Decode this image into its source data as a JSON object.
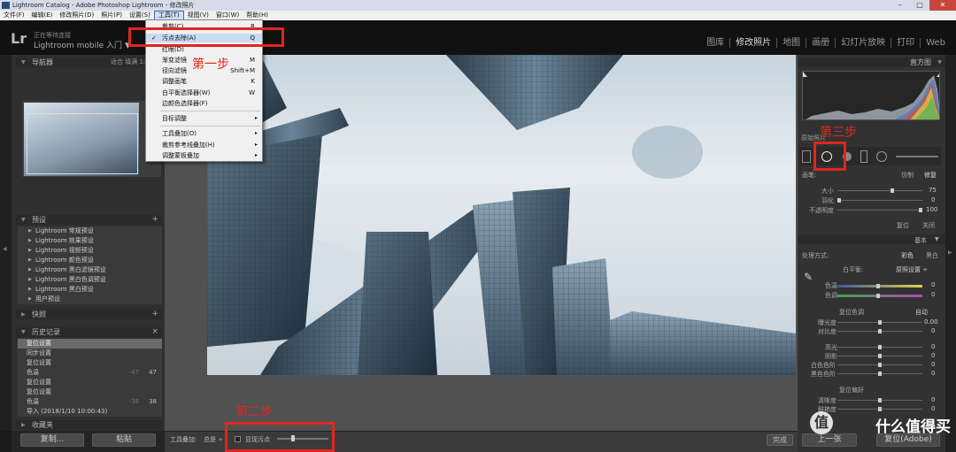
{
  "window": {
    "title": "Lightroom Catalog - Adobe Photoshop Lightroom - 修改照片",
    "buttons": [
      "–",
      "□",
      "✕"
    ]
  },
  "menubar": [
    "文件(F)",
    "编辑(E)",
    "修改照片(D)",
    "照片(P)",
    "设置(S)",
    "工具(T)",
    "视图(V)",
    "窗口(W)",
    "帮助(H)"
  ],
  "header": {
    "logo": "Lr",
    "sync_status": "正在等待连接",
    "mobile": "Lightroom mobile 入门 ▼",
    "modules": [
      "图库",
      "修改照片",
      "地图",
      "画册",
      "幻灯片放映",
      "打印",
      "Web"
    ]
  },
  "tools_menu": {
    "items": [
      {
        "label": "裁剪(C)",
        "shortcut": "R"
      },
      {
        "label": "污点去除(A)",
        "shortcut": "Q",
        "checked": true
      },
      {
        "label": "红眼(D)",
        "shortcut": ""
      },
      {
        "label": "渐变滤镜",
        "shortcut": "M"
      },
      {
        "label": "径向滤镜",
        "shortcut": "Shift+M"
      },
      {
        "label": "调整画笔",
        "shortcut": "K"
      },
      {
        "label": "白平衡选择器(W)",
        "shortcut": "W"
      },
      {
        "label": "边颜色选择器(F)",
        "shortcut": ""
      },
      {
        "label": "目标调整",
        "shortcut": "▸"
      },
      {
        "label": "工具叠加(O)",
        "shortcut": "▸"
      },
      {
        "label": "裁剪参考线叠加(H)",
        "shortcut": "▸"
      },
      {
        "label": "调整蒙板叠加",
        "shortcut": "▸"
      }
    ]
  },
  "left_panel": {
    "navigator": {
      "title": "导航器",
      "zoom_opts": "适合   填满   1:1"
    },
    "presets": {
      "title": "预设",
      "items": [
        "Lightroom 常规预设",
        "Lightroom 效果预设",
        "Lightroom 视频预设",
        "Lightroom 颜色预设",
        "Lightroom 黑白滤镜预设",
        "Lightroom 黑白色调预设",
        "Lightroom 黑白预设",
        "用户预设"
      ]
    },
    "snapshots": {
      "title": "快照"
    },
    "history": {
      "title": "历史记录",
      "close": "×",
      "items": [
        {
          "label": "复位设置",
          "v1": "",
          "v2": ""
        },
        {
          "label": "同步设置",
          "v1": "",
          "v2": ""
        },
        {
          "label": "复位设置",
          "v1": "",
          "v2": ""
        },
        {
          "label": "色温",
          "v1": "-47",
          "v2": "47"
        },
        {
          "label": "复位设置",
          "v1": "",
          "v2": ""
        },
        {
          "label": "复位设置",
          "v1": "",
          "v2": ""
        },
        {
          "label": "色温",
          "v1": "-38",
          "v2": "38"
        },
        {
          "label": "导入 (2018/1/10 10:00:43)",
          "v1": "",
          "v2": ""
        }
      ]
    },
    "collections": {
      "title": "收藏夹"
    },
    "copy_button": "复制...",
    "paste_button": "粘贴"
  },
  "toolbar": {
    "tool_overlay": "工具叠加:",
    "always": "总是 ÷",
    "show_spots": "显现污点",
    "done": "完成"
  },
  "right_panel": {
    "histogram": {
      "title": "直方图"
    },
    "original_photo": "原始照片",
    "brush": {
      "label": "画笔:",
      "mode_clone": "仿制",
      "mode_heal": "修复",
      "size_label": "大小",
      "size_value": "75",
      "feather_label": "羽化",
      "feather_value": "0",
      "opacity_label": "不透明度",
      "opacity_value": "100",
      "reset": "复位",
      "close": "关闭"
    },
    "basic": {
      "title": "基本",
      "treatment_label": "处理方式:",
      "color": "彩色",
      "bw": "黑白",
      "wb_label": "白平衡:",
      "wb_value": "原照设置 ÷",
      "temp_label": "色温",
      "temp_value": "0",
      "tint_label": "色调",
      "tint_value": "0",
      "tone_label": "复位色调",
      "auto": "自动",
      "exposure_label": "曝光度",
      "exposure_value": "0.00",
      "contrast_label": "对比度",
      "contrast_value": "0",
      "highlights_label": "高光",
      "highlights_value": "0",
      "shadows_label": "阴影",
      "shadows_value": "0",
      "whites_label": "白色色阶",
      "whites_value": "0",
      "blacks_label": "黑色色阶",
      "blacks_value": "0",
      "presence_label": "复位偏好",
      "clarity_label": "清晰度",
      "clarity_value": "0",
      "vibrance_label": "鲜艳度",
      "vibrance_value": "0"
    },
    "bottom_buttons": [
      "上一张",
      "复位(Adobe)"
    ]
  },
  "annotations": {
    "step1": "第一步",
    "step2": "第二步",
    "step3": "第三步",
    "color": "#e0261e"
  },
  "watermark": {
    "icon": "值",
    "text": "什么值得买"
  }
}
